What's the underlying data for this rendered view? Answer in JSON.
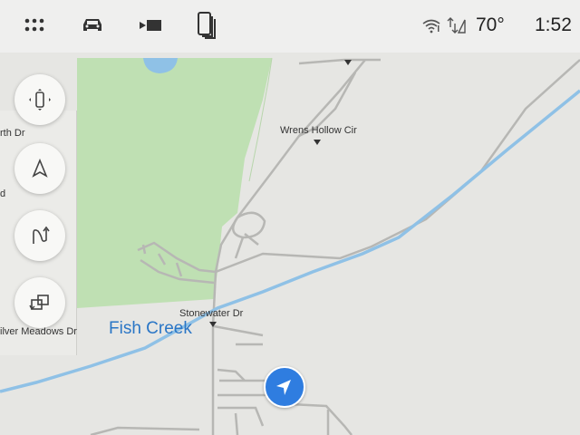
{
  "topbar": {
    "icons": [
      "apps-grid-icon",
      "vehicle-icon",
      "media-source-icon",
      "phone-icon"
    ],
    "wifi_icon": "wifi-icon",
    "signal_icon": "signal-icon",
    "temperature": "70°",
    "time": "1:52"
  },
  "map_controls": {
    "buttons": [
      "vehicle-view-icon",
      "navigation-arrow-icon",
      "route-icon",
      "rotate-view-icon"
    ]
  },
  "map": {
    "labels": {
      "wrens_hollow": "Wrens Hollow Cir",
      "stonewater": "Stonewater Dr",
      "fish_creek": "Fish Creek",
      "silver_meadows": "ilver Meadows Dr",
      "north_dr": "rth Dr",
      "d_label": "d"
    },
    "colors": {
      "park": "#bfe0b3",
      "water": "#8fc1e6",
      "road": "#b7b7b4",
      "accent": "#2f7de0"
    }
  }
}
